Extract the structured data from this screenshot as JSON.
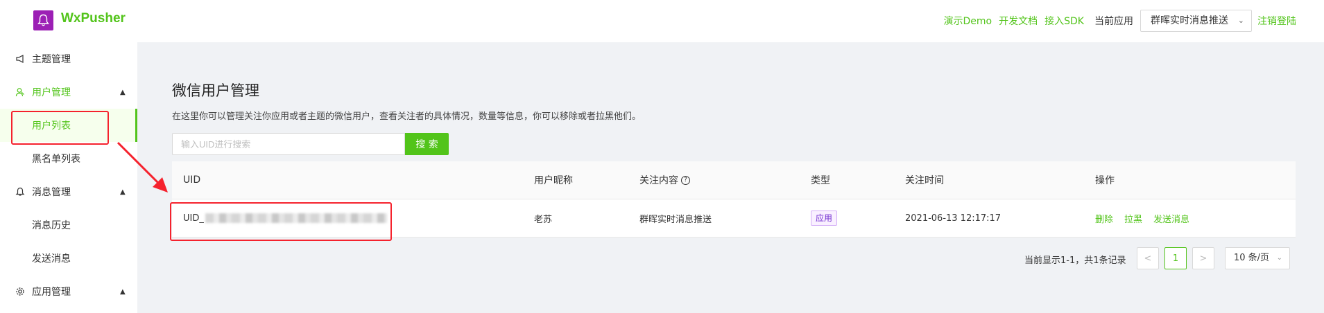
{
  "header": {
    "brand": "WxPusher",
    "links": [
      "演示Demo",
      "开发文档",
      "接入SDK"
    ],
    "current_app_label": "当前应用",
    "current_app_value": "群晖实时消息推送",
    "logout": "注销登陆"
  },
  "sidebar": {
    "items": [
      {
        "label": "主题管理",
        "icon": "megaphone-icon"
      },
      {
        "label": "用户管理",
        "icon": "user-icon"
      },
      {
        "label": "用户列表"
      },
      {
        "label": "黑名单列表"
      },
      {
        "label": "消息管理",
        "icon": "bell-icon"
      },
      {
        "label": "消息历史"
      },
      {
        "label": "发送消息"
      },
      {
        "label": "应用管理",
        "icon": "gear-icon"
      }
    ]
  },
  "main": {
    "title": "微信用户管理",
    "description": "在这里你可以管理关注你应用或者主题的微信用户，查看关注者的具体情况，数量等信息，你可以移除或者拉黑他们。",
    "search_placeholder": "输入UID进行搜索",
    "search_button": "搜 索",
    "table": {
      "columns": [
        "UID",
        "用户昵称",
        "关注内容",
        "类型",
        "关注时间",
        "操作"
      ],
      "rows": [
        {
          "uid_prefix": "UID_",
          "nickname": "老苏",
          "follow": "群晖实时消息推送",
          "type": "应用",
          "time": "2021-06-13 12:17:17",
          "actions": [
            "删除",
            "拉黑",
            "发送消息"
          ]
        }
      ]
    },
    "pagination": {
      "total_text": "当前显示1-1，共1条记录",
      "current_page": "1",
      "prev": "<",
      "next": ">",
      "page_size": "10 条/页"
    }
  },
  "colors": {
    "accent": "#52c41a",
    "annotation": "#f5222d",
    "badge": "#722ed1",
    "logo_bg": "#9c1fb5"
  }
}
